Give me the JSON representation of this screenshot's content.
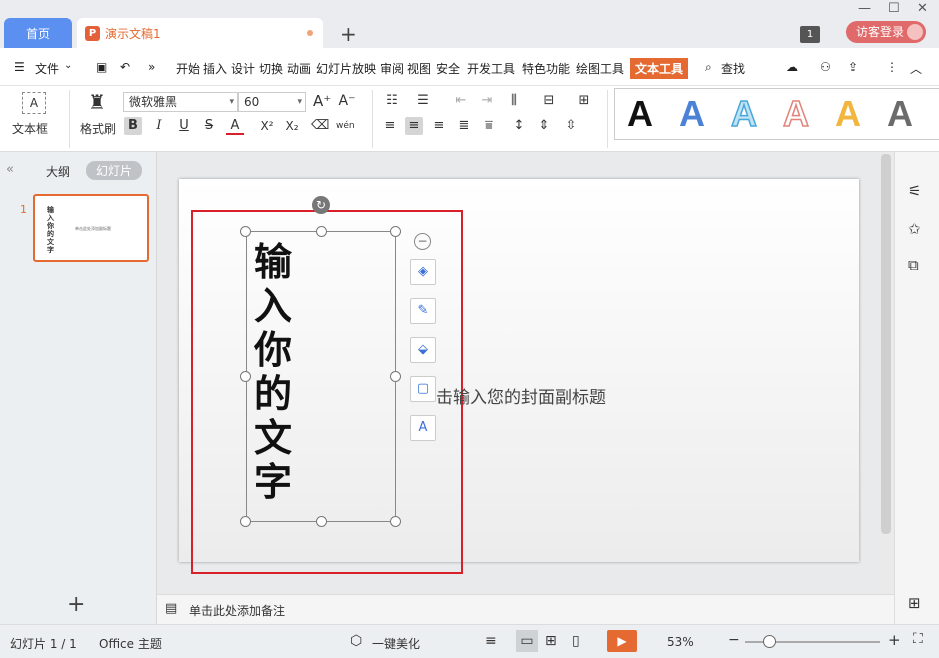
{
  "tabs": {
    "home": "首页",
    "doc": "演示文稿1"
  },
  "window": {
    "badge": "1",
    "login": "访客登录"
  },
  "menu": {
    "file": "文件",
    "items": [
      "开始",
      "插入",
      "设计",
      "切换",
      "动画",
      "幻灯片放映",
      "审阅",
      "视图",
      "安全",
      "开发工具",
      "特色功能",
      "绘图工具"
    ],
    "active": "文本工具",
    "search": "查找"
  },
  "ribbon": {
    "textbox": "文本框",
    "format_painter": "格式刷",
    "font": "微软雅黑",
    "font_size": "60",
    "bold": "B",
    "italic": "I",
    "underline": "U",
    "strike": "S",
    "fontcolor": "A",
    "super": "X²",
    "sub": "X₂",
    "phonetic": "wén",
    "style_letter": "A"
  },
  "left": {
    "outline": "大纲",
    "slides": "幻灯片",
    "slide_num": "1",
    "thumb_text": "输入你的文字",
    "thumb_sub": "单击此处添加副标题"
  },
  "slide": {
    "title_chars": [
      "输",
      "入",
      "你",
      "的",
      "文",
      "字"
    ],
    "subtitle": "击输入您的封面副标题"
  },
  "notes": {
    "placeholder": "单击此处添加备注"
  },
  "status": {
    "slide": "幻灯片 1 / 1",
    "theme": "Office 主题",
    "beautify": "一键美化",
    "zoom": "53%"
  },
  "colors": {
    "accent": "#e46a32",
    "highlight": "#d9202a",
    "home_tab": "#5b8ff0"
  }
}
